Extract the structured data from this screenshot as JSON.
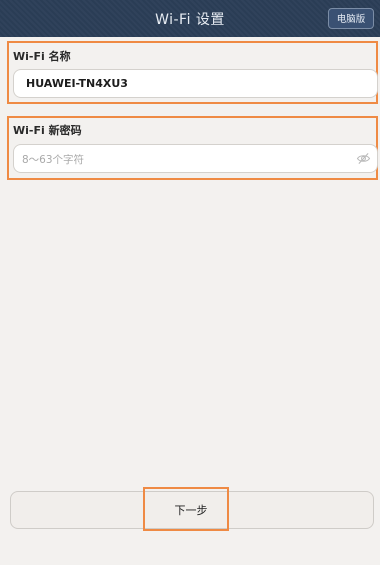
{
  "header": {
    "title": "Wi-Fi 设置",
    "pc_version_label": "电脑版"
  },
  "wifi_name": {
    "label": "Wi-Fi 名称",
    "value": "HUAWEI-TN4XU3"
  },
  "wifi_password": {
    "label": "Wi-Fi 新密码",
    "placeholder": "8～63个字符",
    "icon": "eye-hidden-icon"
  },
  "actions": {
    "next_label": "下一步"
  },
  "colors": {
    "header_bg": "#2b3e57",
    "highlight": "#ef8a44",
    "page_bg": "#f3f1ef"
  }
}
